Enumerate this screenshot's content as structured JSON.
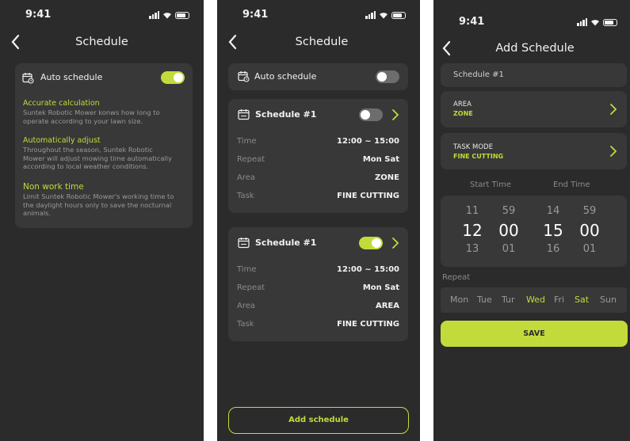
{
  "status_bar": {
    "time": "9:41"
  },
  "screen1": {
    "title": "Schedule",
    "auto_schedule_label": "Auto schedule",
    "auto_schedule_on": true,
    "sections": [
      {
        "heading": "Accurate calculation",
        "body": [
          "Suntek Robotic Mower konws how long to",
          "operate according to your lawn size."
        ]
      },
      {
        "heading": "Automatically adjust",
        "body": [
          "Throughout the season, Suntek Robotic",
          "Mower will adjust mowing time automatically",
          "according to local weather conditions."
        ]
      },
      {
        "heading": "Non work time",
        "body": [
          "Limit Suntek Robotic Mower's working time to",
          "the daylight hours only to save the nocturnal",
          "animals."
        ]
      }
    ]
  },
  "screen2": {
    "title": "Schedule",
    "auto_schedule_label": "Auto schedule",
    "auto_schedule_on": false,
    "schedules": [
      {
        "name": "Schedule #1",
        "enabled": false,
        "rows": [
          {
            "key": "Time",
            "value": "12:00 ~ 15:00"
          },
          {
            "key": "Repeat",
            "value": "Mon  Sat"
          },
          {
            "key": "Area",
            "value": "ZONE"
          },
          {
            "key": "Task",
            "value": "FINE CUTTING"
          }
        ]
      },
      {
        "name": "Schedule #1",
        "enabled": true,
        "rows": [
          {
            "key": "Time",
            "value": "12:00 ~ 15:00"
          },
          {
            "key": "Repeat",
            "value": "Mon  Sat"
          },
          {
            "key": "Area",
            "value": "AREA"
          },
          {
            "key": "Task",
            "value": "FINE CUTTING"
          }
        ]
      }
    ],
    "add_button": "Add schedule"
  },
  "screen3": {
    "title": "Add Schedule",
    "name_value": "Schedule #1",
    "area_label": "AREA",
    "area_value": "ZONE",
    "task_label": "TASK MODE",
    "task_value": "FINE CUTTING",
    "start_time_label": "Start Time",
    "end_time_label": "End Time",
    "picker": [
      {
        "prev": "11",
        "current": "12",
        "next": "13"
      },
      {
        "prev": "59",
        "current": "00",
        "next": "01"
      },
      {
        "prev": "14",
        "current": "15",
        "next": "16"
      },
      {
        "prev": "59",
        "current": "00",
        "next": "01"
      }
    ],
    "repeat_label": "Repeat",
    "days": [
      {
        "label": "Mon",
        "selected": false
      },
      {
        "label": "Tue",
        "selected": false
      },
      {
        "label": "Tur",
        "selected": false
      },
      {
        "label": "Wed",
        "selected": true
      },
      {
        "label": "Fri",
        "selected": false
      },
      {
        "label": "Sat",
        "selected": true
      },
      {
        "label": "Sun",
        "selected": false
      }
    ],
    "save_button": "SAVE"
  },
  "colors": {
    "accent": "#c3db3a",
    "background": "#2b2b2b",
    "card": "#383838"
  },
  "icons": [
    "chevron-left-icon",
    "calendar-clock-icon",
    "chevron-right-icon",
    "signal-icon",
    "wifi-icon",
    "battery-icon"
  ]
}
